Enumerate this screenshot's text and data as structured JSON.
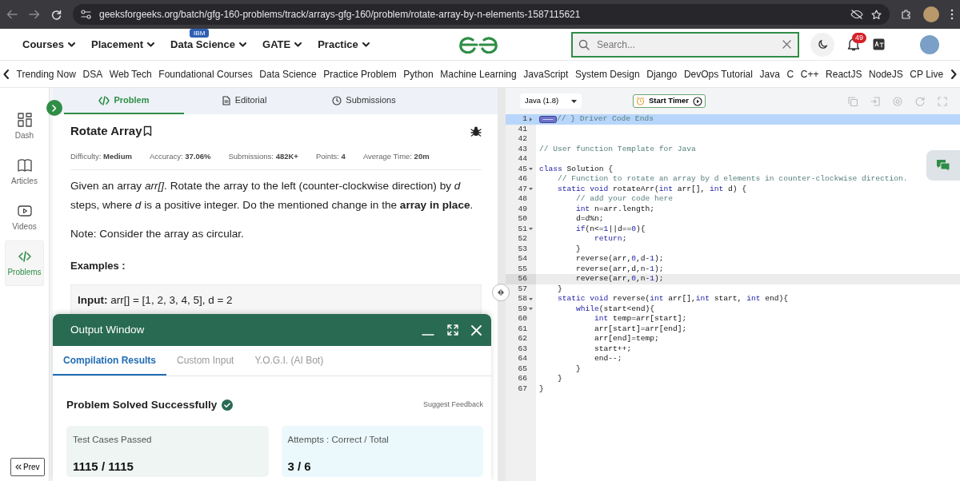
{
  "browser": {
    "url": "geeksforgeeks.org/batch/gfg-160-problems/track/arrays-gfg-160/problem/rotate-array-by-n-elements-1587115621"
  },
  "header": {
    "nav": [
      {
        "label": "Courses"
      },
      {
        "label": "Placement"
      },
      {
        "label": "Data Science",
        "badge": "IBM"
      },
      {
        "label": "GATE"
      },
      {
        "label": "Practice"
      }
    ],
    "search": {
      "placeholder": "Search..."
    },
    "notifications": "49"
  },
  "categories": [
    "Trending Now",
    "DSA",
    "Web Tech",
    "Foundational Courses",
    "Data Science",
    "Practice Problem",
    "Python",
    "Machine Learning",
    "JavaScript",
    "System Design",
    "Django",
    "DevOps Tutorial",
    "Java",
    "C",
    "C++",
    "ReactJS",
    "NodeJS",
    "CP Live"
  ],
  "sidebar": [
    {
      "label": "Dash",
      "selected": false
    },
    {
      "label": "Articles",
      "selected": false
    },
    {
      "label": "Videos",
      "selected": false
    },
    {
      "label": "Problems",
      "selected": true
    }
  ],
  "prev_button": "Prev",
  "problem_tabs": [
    {
      "label": "Problem",
      "selected": true
    },
    {
      "label": "Editorial",
      "selected": false
    },
    {
      "label": "Submissions",
      "selected": false
    }
  ],
  "problem": {
    "title": "Rotate Array",
    "meta": [
      {
        "label": "Difficulty:",
        "value": "Medium"
      },
      {
        "label": "Accuracy:",
        "value": "37.06%"
      },
      {
        "label": "Submissions:",
        "value": "482K+"
      },
      {
        "label": "Points:",
        "value": "4"
      },
      {
        "label": "Average Time:",
        "value": "20m"
      }
    ],
    "paragraphs": [
      "Given an array *arr[]*. Rotate the array to the left (counter-clockwise direction) by *d* steps, where *d* is a positive integer. Do the mentioned change in the **array in place**.",
      "Note: Consider the array as circular."
    ],
    "examples_heading": "Examples :",
    "example": "**Input:** arr[] = [1, 2, 3, 4, 5], d = 2"
  },
  "output_window": {
    "title": "Output Window",
    "tabs": [
      {
        "label": "Compilation Results",
        "selected": true
      },
      {
        "label": "Custom Input",
        "selected": false
      },
      {
        "label": "Y.O.G.I. (AI Bot)",
        "selected": false
      }
    ],
    "status": "Problem Solved Successfully",
    "feedback_link": "Suggest Feedback",
    "stats": [
      {
        "label": "Test Cases Passed",
        "value": "1115 / 1115",
        "color": "#eef5f2"
      },
      {
        "label": "Attempts : Correct / Total",
        "value": "3 / 6",
        "color": "#ebf9fc"
      }
    ]
  },
  "editor": {
    "language": "Java (1.8)",
    "timer_button": "Start Timer",
    "lines": [
      {
        "number": "1",
        "foldable": true,
        "collapsed": true,
        "selected": true,
        "current": false,
        "parts": [
          {
            "kind": "comment",
            "text": "// } Driver Code Ends"
          }
        ]
      },
      {
        "number": "41",
        "foldable": false,
        "collapsed": false,
        "selected": false,
        "current": false
      },
      {
        "number": "42",
        "foldable": false,
        "collapsed": false,
        "selected": false,
        "current": false
      },
      {
        "number": "43",
        "foldable": false,
        "collapsed": false,
        "selected": false,
        "current": false,
        "parts": [
          {
            "kind": "comment",
            "text": "// User function Template for Java"
          }
        ]
      },
      {
        "number": "44",
        "foldable": false,
        "collapsed": false,
        "selected": false,
        "current": false
      },
      {
        "number": "45",
        "foldable": true,
        "collapsed": false,
        "selected": false,
        "current": false,
        "parts": [
          {
            "kind": "keyword",
            "text": "class"
          },
          {
            "text": " Solution {"
          }
        ]
      },
      {
        "number": "46",
        "foldable": false,
        "collapsed": false,
        "selected": false,
        "current": false,
        "parts": [
          {
            "kind": "comment",
            "text": "    // Function to rotate an array by d elements in counter-clockwise direction."
          }
        ]
      },
      {
        "number": "47",
        "foldable": true,
        "collapsed": false,
        "selected": false,
        "current": false,
        "parts": [
          {
            "kind": "keyword",
            "text": "    static void"
          },
          {
            "text": " rotateArr("
          },
          {
            "kind": "keyword",
            "text": "int"
          },
          {
            "text": " arr[], "
          },
          {
            "kind": "keyword",
            "text": "int"
          },
          {
            "text": " d) {"
          }
        ]
      },
      {
        "number": "48",
        "foldable": false,
        "collapsed": false,
        "selected": false,
        "current": false,
        "parts": [
          {
            "kind": "comment",
            "text": "        // add your code here"
          }
        ]
      },
      {
        "number": "49",
        "foldable": false,
        "collapsed": false,
        "selected": false,
        "current": false,
        "parts": [
          {
            "kind": "keyword",
            "text": "        int"
          },
          {
            "text": " n=arr.length;"
          }
        ]
      },
      {
        "number": "50",
        "foldable": false,
        "collapsed": false,
        "selected": false,
        "current": false,
        "parts": [
          {
            "text": "        d=d%n;"
          }
        ]
      },
      {
        "number": "51",
        "foldable": true,
        "collapsed": false,
        "selected": false,
        "current": false,
        "parts": [
          {
            "kind": "keyword",
            "text": "        if"
          },
          {
            "text": "(n<="
          },
          {
            "kind": "number",
            "text": "1"
          },
          {
            "text": "||d=="
          },
          {
            "kind": "number",
            "text": "0"
          },
          {
            "text": "){"
          }
        ]
      },
      {
        "number": "52",
        "foldable": false,
        "collapsed": false,
        "selected": false,
        "current": false,
        "parts": [
          {
            "kind": "keyword",
            "text": "            return"
          },
          {
            "text": ";"
          }
        ]
      },
      {
        "number": "53",
        "foldable": false,
        "collapsed": false,
        "selected": false,
        "current": false,
        "parts": [
          {
            "text": "        }"
          }
        ]
      },
      {
        "number": "54",
        "foldable": false,
        "collapsed": false,
        "selected": false,
        "current": false,
        "parts": [
          {
            "text": "        reverse(arr,"
          },
          {
            "kind": "number",
            "text": "0"
          },
          {
            "text": ",d-"
          },
          {
            "kind": "number",
            "text": "1"
          },
          {
            "text": ");"
          }
        ]
      },
      {
        "number": "55",
        "foldable": false,
        "collapsed": false,
        "selected": false,
        "current": false,
        "parts": [
          {
            "text": "        reverse(arr,d,n-"
          },
          {
            "kind": "number",
            "text": "1"
          },
          {
            "text": ");"
          }
        ]
      },
      {
        "number": "56",
        "foldable": false,
        "collapsed": false,
        "selected": false,
        "current": true,
        "parts": [
          {
            "text": "        reverse(arr,"
          },
          {
            "kind": "number",
            "text": "0"
          },
          {
            "text": ",n-"
          },
          {
            "kind": "number",
            "text": "1"
          },
          {
            "text": ");"
          }
        ]
      },
      {
        "number": "57",
        "foldable": false,
        "collapsed": false,
        "selected": false,
        "current": false,
        "parts": [
          {
            "text": "    }"
          }
        ]
      },
      {
        "number": "58",
        "foldable": true,
        "collapsed": false,
        "selected": false,
        "current": false,
        "parts": [
          {
            "kind": "keyword",
            "text": "    static void"
          },
          {
            "text": " reverse("
          },
          {
            "kind": "keyword",
            "text": "int"
          },
          {
            "text": " arr[],"
          },
          {
            "kind": "keyword",
            "text": "int"
          },
          {
            "text": " start, "
          },
          {
            "kind": "keyword",
            "text": "int"
          },
          {
            "text": " end){"
          }
        ]
      },
      {
        "number": "59",
        "foldable": true,
        "collapsed": false,
        "selected": false,
        "current": false,
        "parts": [
          {
            "kind": "keyword",
            "text": "        while"
          },
          {
            "text": "(start<end){"
          }
        ]
      },
      {
        "number": "60",
        "foldable": false,
        "collapsed": false,
        "selected": false,
        "current": false,
        "parts": [
          {
            "kind": "keyword",
            "text": "            int"
          },
          {
            "text": " temp=arr[start];"
          }
        ]
      },
      {
        "number": "61",
        "foldable": false,
        "collapsed": false,
        "selected": false,
        "current": false,
        "parts": [
          {
            "text": "            arr[start]=arr[end];"
          }
        ]
      },
      {
        "number": "62",
        "foldable": false,
        "collapsed": false,
        "selected": false,
        "current": false,
        "parts": [
          {
            "text": "            arr[end]=temp;"
          }
        ]
      },
      {
        "number": "63",
        "foldable": false,
        "collapsed": false,
        "selected": false,
        "current": false,
        "parts": [
          {
            "text": "            start++;"
          }
        ]
      },
      {
        "number": "64",
        "foldable": false,
        "collapsed": false,
        "selected": false,
        "current": false,
        "parts": [
          {
            "text": "            end--;"
          }
        ]
      },
      {
        "number": "65",
        "foldable": false,
        "collapsed": false,
        "selected": false,
        "current": false,
        "parts": [
          {
            "text": "        }"
          }
        ]
      },
      {
        "number": "66",
        "foldable": false,
        "collapsed": false,
        "selected": false,
        "current": false,
        "parts": [
          {
            "text": "    }"
          }
        ]
      },
      {
        "number": "67",
        "foldable": false,
        "collapsed": false,
        "selected": false,
        "current": false,
        "parts": [
          {
            "text": "}"
          }
        ]
      }
    ]
  }
}
